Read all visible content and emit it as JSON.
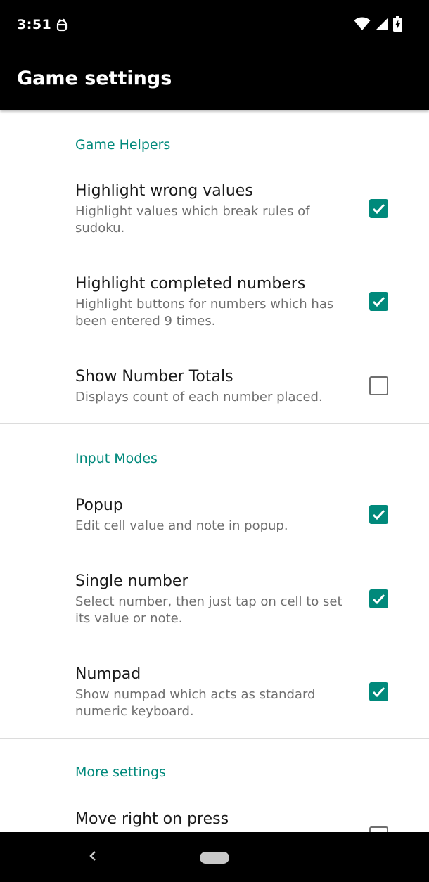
{
  "status_bar": {
    "time": "3:51",
    "icons": [
      "notification-android-icon",
      "wifi-icon",
      "cell-signal-icon",
      "battery-charging-icon"
    ]
  },
  "app_bar": {
    "title": "Game settings"
  },
  "sections": {
    "game_helpers": {
      "header": "Game Helpers",
      "items": [
        {
          "title": "Highlight wrong values",
          "summary": "Highlight values which break rules of sudoku.",
          "checked": true
        },
        {
          "title": "Highlight completed numbers",
          "summary": "Highlight buttons for numbers which has been entered 9 times.",
          "checked": true
        },
        {
          "title": "Show Number Totals",
          "summary": "Displays count of each number placed.",
          "checked": false
        }
      ]
    },
    "input_modes": {
      "header": "Input Modes",
      "items": [
        {
          "title": "Popup",
          "summary": "Edit cell value and note in popup.",
          "checked": true
        },
        {
          "title": "Single number",
          "summary": "Select number, then just tap on cell to set its value or note.",
          "checked": true
        },
        {
          "title": "Numpad",
          "summary": "Show numpad which acts as standard numeric keyboard.",
          "checked": true
        }
      ]
    },
    "more_settings": {
      "header": "More settings",
      "items": [
        {
          "title": "Move right on press",
          "checked": false
        }
      ]
    }
  },
  "colors": {
    "accent": "#00897b",
    "app_bar": "#000000",
    "title_text": "#1a1a1a",
    "summary_text": "#6f6f6f"
  },
  "nav_bar": {
    "icons": [
      "back-icon",
      "home-pill-icon"
    ]
  }
}
